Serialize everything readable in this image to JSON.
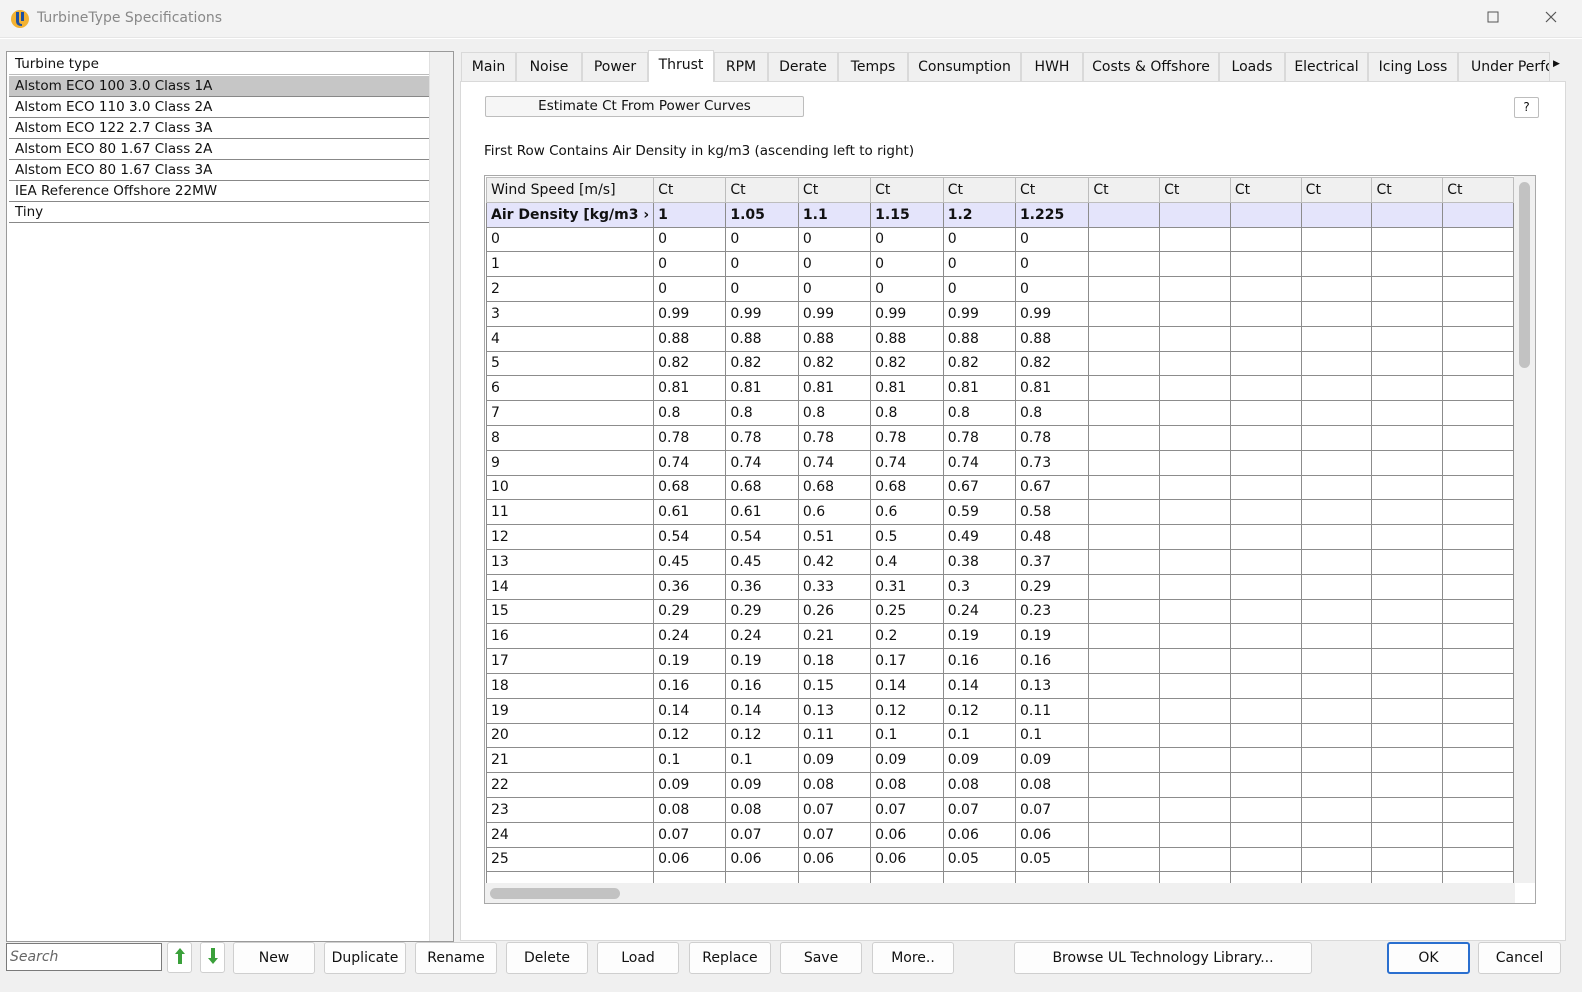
{
  "window": {
    "title": "TurbineType Specifications"
  },
  "icons": {
    "app": "ul-logo-icon",
    "maximize": "maximize-icon",
    "close": "close-icon",
    "move_up": "arrow-up-green-icon",
    "move_down": "arrow-down-green-icon",
    "tab_scroll": "chevron-right-icon"
  },
  "colors": {
    "accent": "#2a6fcf",
    "selected_row": "#c6c6c6",
    "density_row": "#e4e4fb",
    "arrow_green": "#3aa03a"
  },
  "list": {
    "header": "Turbine type",
    "items": [
      {
        "label": "Alstom ECO 100 3.0 Class 1A",
        "selected": true
      },
      {
        "label": "Alstom ECO 110 3.0 Class 2A",
        "selected": false
      },
      {
        "label": "Alstom ECO 122 2.7 Class 3A",
        "selected": false
      },
      {
        "label": "Alstom ECO 80 1.67 Class 2A",
        "selected": false
      },
      {
        "label": "Alstom ECO 80 1.67 Class 3A",
        "selected": false
      },
      {
        "label": "IEA Reference Offshore 22MW",
        "selected": false
      },
      {
        "label": "Tiny",
        "selected": false
      }
    ]
  },
  "tabs": [
    {
      "label": "Main",
      "active": false
    },
    {
      "label": "Noise",
      "active": false
    },
    {
      "label": "Power",
      "active": false
    },
    {
      "label": "Thrust",
      "active": true
    },
    {
      "label": "RPM",
      "active": false
    },
    {
      "label": "Derate",
      "active": false
    },
    {
      "label": "Temps",
      "active": false
    },
    {
      "label": "Consumption",
      "active": false
    },
    {
      "label": "HWH",
      "active": false
    },
    {
      "label": "Costs & Offshore",
      "active": false
    },
    {
      "label": "Loads",
      "active": false
    },
    {
      "label": "Electrical",
      "active": false
    },
    {
      "label": "Icing Loss",
      "active": false
    },
    {
      "label": "Under Perfo",
      "active": false
    }
  ],
  "thrust": {
    "estimate_button": "Estimate Ct From Power Curves",
    "help_button": "?",
    "info_text": "First Row Contains Air Density in kg/m3 (ascending left to right)",
    "grid": {
      "headers": [
        "Wind Speed [m/s]",
        "Ct",
        "Ct",
        "Ct",
        "Ct",
        "Ct",
        "Ct",
        "Ct",
        "Ct",
        "Ct",
        "Ct",
        "Ct",
        "Ct"
      ],
      "density_row": [
        "Air Density [kg/m3 ›",
        "1",
        "1.05",
        "1.1",
        "1.15",
        "1.2",
        "1.225",
        "",
        "",
        "",
        "",
        "",
        ""
      ],
      "rows": [
        [
          "0",
          "0",
          "0",
          "0",
          "0",
          "0",
          "0"
        ],
        [
          "1",
          "0",
          "0",
          "0",
          "0",
          "0",
          "0"
        ],
        [
          "2",
          "0",
          "0",
          "0",
          "0",
          "0",
          "0"
        ],
        [
          "3",
          "0.99",
          "0.99",
          "0.99",
          "0.99",
          "0.99",
          "0.99"
        ],
        [
          "4",
          "0.88",
          "0.88",
          "0.88",
          "0.88",
          "0.88",
          "0.88"
        ],
        [
          "5",
          "0.82",
          "0.82",
          "0.82",
          "0.82",
          "0.82",
          "0.82"
        ],
        [
          "6",
          "0.81",
          "0.81",
          "0.81",
          "0.81",
          "0.81",
          "0.81"
        ],
        [
          "7",
          "0.8",
          "0.8",
          "0.8",
          "0.8",
          "0.8",
          "0.8"
        ],
        [
          "8",
          "0.78",
          "0.78",
          "0.78",
          "0.78",
          "0.78",
          "0.78"
        ],
        [
          "9",
          "0.74",
          "0.74",
          "0.74",
          "0.74",
          "0.74",
          "0.73"
        ],
        [
          "10",
          "0.68",
          "0.68",
          "0.68",
          "0.68",
          "0.67",
          "0.67"
        ],
        [
          "11",
          "0.61",
          "0.61",
          "0.6",
          "0.6",
          "0.59",
          "0.58"
        ],
        [
          "12",
          "0.54",
          "0.54",
          "0.51",
          "0.5",
          "0.49",
          "0.48"
        ],
        [
          "13",
          "0.45",
          "0.45",
          "0.42",
          "0.4",
          "0.38",
          "0.37"
        ],
        [
          "14",
          "0.36",
          "0.36",
          "0.33",
          "0.31",
          "0.3",
          "0.29"
        ],
        [
          "15",
          "0.29",
          "0.29",
          "0.26",
          "0.25",
          "0.24",
          "0.23"
        ],
        [
          "16",
          "0.24",
          "0.24",
          "0.21",
          "0.2",
          "0.19",
          "0.19"
        ],
        [
          "17",
          "0.19",
          "0.19",
          "0.18",
          "0.17",
          "0.16",
          "0.16"
        ],
        [
          "18",
          "0.16",
          "0.16",
          "0.15",
          "0.14",
          "0.14",
          "0.13"
        ],
        [
          "19",
          "0.14",
          "0.14",
          "0.13",
          "0.12",
          "0.12",
          "0.11"
        ],
        [
          "20",
          "0.12",
          "0.12",
          "0.11",
          "0.1",
          "0.1",
          "0.1"
        ],
        [
          "21",
          "0.1",
          "0.1",
          "0.09",
          "0.09",
          "0.09",
          "0.09"
        ],
        [
          "22",
          "0.09",
          "0.09",
          "0.08",
          "0.08",
          "0.08",
          "0.08"
        ],
        [
          "23",
          "0.08",
          "0.08",
          "0.07",
          "0.07",
          "0.07",
          "0.07"
        ],
        [
          "24",
          "0.07",
          "0.07",
          "0.07",
          "0.06",
          "0.06",
          "0.06"
        ],
        [
          "25",
          "0.06",
          "0.06",
          "0.06",
          "0.06",
          "0.05",
          "0.05"
        ],
        [
          "",
          "",
          "",
          "",
          "",
          "",
          ""
        ]
      ]
    }
  },
  "bottom": {
    "search_placeholder": "Search",
    "search_value": "",
    "new": "New",
    "duplicate": "Duplicate",
    "rename": "Rename",
    "delete": "Delete",
    "load": "Load",
    "replace": "Replace",
    "save": "Save",
    "more": "More..",
    "browse": "Browse UL Technology Library...",
    "ok": "OK",
    "cancel": "Cancel"
  }
}
